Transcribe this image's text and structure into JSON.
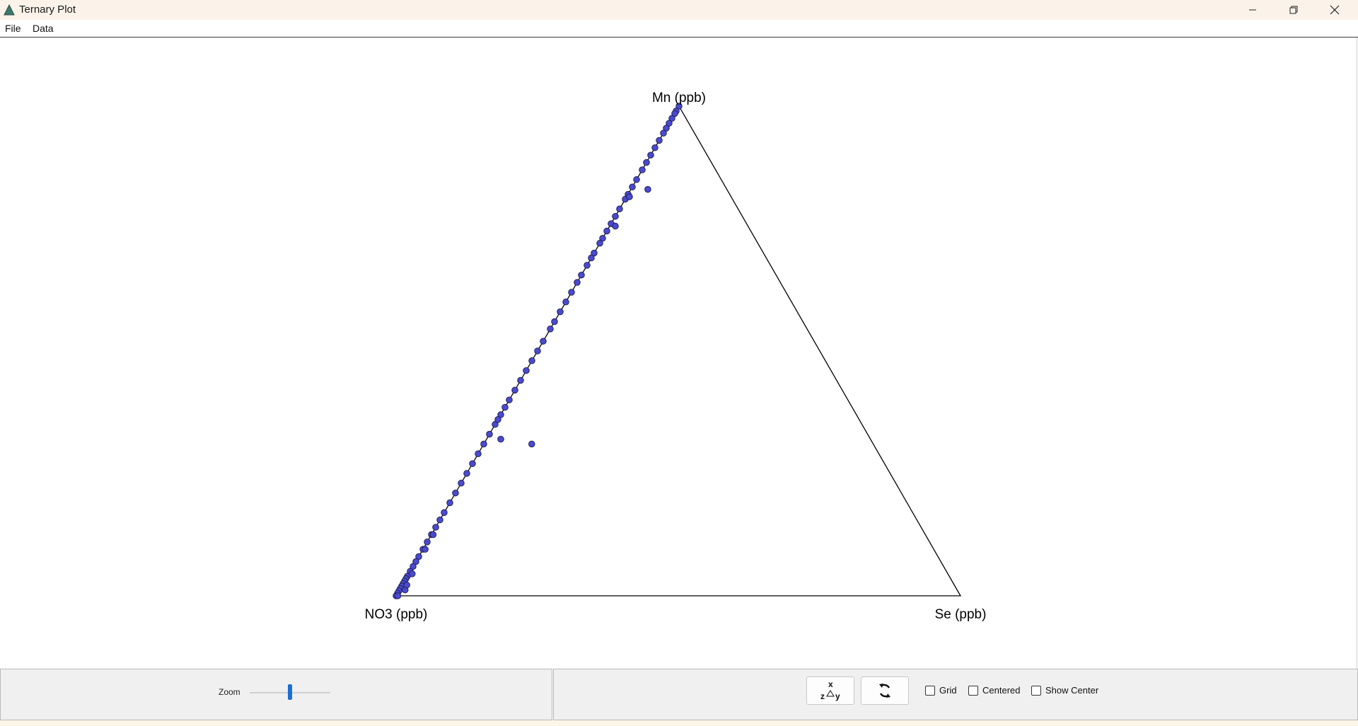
{
  "window": {
    "title": "Ternary Plot"
  },
  "menu": {
    "items": [
      "File",
      "Data"
    ]
  },
  "plot": {
    "top_label": "Mn (ppb)",
    "left_label": "NO3 (ppb)",
    "right_label": "Se (ppb)",
    "point_color": "#4a4ad0",
    "point_stroke": "#1a1a4a"
  },
  "chart_data": {
    "type": "scatter",
    "subtype": "ternary",
    "components": [
      "Mn (ppb)",
      "NO3 (ppb)",
      "Se (ppb)"
    ],
    "grid": false,
    "points": [
      {
        "Mn": 1.0,
        "Se": 0.0
      },
      {
        "Mn": 0.99,
        "Se": 0.0
      },
      {
        "Mn": 0.985,
        "Se": 0.0
      },
      {
        "Mn": 0.975,
        "Se": 0.0
      },
      {
        "Mn": 0.965,
        "Se": 0.0
      },
      {
        "Mn": 0.955,
        "Se": 0.0
      },
      {
        "Mn": 0.945,
        "Se": 0.0
      },
      {
        "Mn": 0.93,
        "Se": 0.0
      },
      {
        "Mn": 0.915,
        "Se": 0.0
      },
      {
        "Mn": 0.9,
        "Se": 0.0
      },
      {
        "Mn": 0.885,
        "Se": 0.0
      },
      {
        "Mn": 0.87,
        "Se": 0.0
      },
      {
        "Mn": 0.85,
        "Se": 0.0
      },
      {
        "Mn": 0.835,
        "Se": 0.0
      },
      {
        "Mn": 0.82,
        "Se": 0.0
      },
      {
        "Mn": 0.81,
        "Se": 0.0
      },
      {
        "Mn": 0.79,
        "Se": 0.0
      },
      {
        "Mn": 0.775,
        "Se": 0.0
      },
      {
        "Mn": 0.76,
        "Se": 0.0
      },
      {
        "Mn": 0.745,
        "Se": 0.0
      },
      {
        "Mn": 0.73,
        "Se": 0.0
      },
      {
        "Mn": 0.72,
        "Se": 0.0
      },
      {
        "Mn": 0.7,
        "Se": 0.0
      },
      {
        "Mn": 0.69,
        "Se": 0.0
      },
      {
        "Mn": 0.675,
        "Se": 0.0
      },
      {
        "Mn": 0.655,
        "Se": 0.0
      },
      {
        "Mn": 0.64,
        "Se": 0.0
      },
      {
        "Mn": 0.62,
        "Se": 0.0
      },
      {
        "Mn": 0.6,
        "Se": 0.0
      },
      {
        "Mn": 0.58,
        "Se": 0.0
      },
      {
        "Mn": 0.56,
        "Se": 0.0
      },
      {
        "Mn": 0.545,
        "Se": 0.0
      },
      {
        "Mn": 0.52,
        "Se": 0.0
      },
      {
        "Mn": 0.5,
        "Se": 0.0
      },
      {
        "Mn": 0.48,
        "Se": 0.0
      },
      {
        "Mn": 0.46,
        "Se": 0.0
      },
      {
        "Mn": 0.44,
        "Se": 0.0
      },
      {
        "Mn": 0.42,
        "Se": 0.0
      },
      {
        "Mn": 0.4,
        "Se": 0.0
      },
      {
        "Mn": 0.385,
        "Se": 0.0
      },
      {
        "Mn": 0.37,
        "Se": 0.0
      },
      {
        "Mn": 0.35,
        "Se": 0.0
      },
      {
        "Mn": 0.33,
        "Se": 0.0
      },
      {
        "Mn": 0.31,
        "Se": 0.0
      },
      {
        "Mn": 0.29,
        "Se": 0.0
      },
      {
        "Mn": 0.27,
        "Se": 0.0
      },
      {
        "Mn": 0.25,
        "Se": 0.0
      },
      {
        "Mn": 0.23,
        "Se": 0.0
      },
      {
        "Mn": 0.21,
        "Se": 0.0
      },
      {
        "Mn": 0.19,
        "Se": 0.0
      },
      {
        "Mn": 0.17,
        "Se": 0.0
      },
      {
        "Mn": 0.155,
        "Se": 0.0
      },
      {
        "Mn": 0.14,
        "Se": 0.0
      },
      {
        "Mn": 0.125,
        "Se": 0.0
      },
      {
        "Mn": 0.11,
        "Se": 0.0
      },
      {
        "Mn": 0.095,
        "Se": 0.0
      },
      {
        "Mn": 0.08,
        "Se": 0.0
      },
      {
        "Mn": 0.07,
        "Se": 0.0
      },
      {
        "Mn": 0.06,
        "Se": 0.0
      },
      {
        "Mn": 0.05,
        "Se": 0.0
      },
      {
        "Mn": 0.04,
        "Se": 0.0
      },
      {
        "Mn": 0.035,
        "Se": 0.0
      },
      {
        "Mn": 0.03,
        "Se": 0.0
      },
      {
        "Mn": 0.025,
        "Se": 0.0
      },
      {
        "Mn": 0.02,
        "Se": 0.0
      },
      {
        "Mn": 0.015,
        "Se": 0.0
      },
      {
        "Mn": 0.01,
        "Se": 0.0
      },
      {
        "Mn": 0.005,
        "Se": 0.0
      },
      {
        "Mn": 0.0,
        "Se": 0.0
      },
      {
        "Mn": 0.0,
        "Se": 0.003
      },
      {
        "Mn": 0.012,
        "Se": 0.01
      },
      {
        "Mn": 0.022,
        "Se": 0.008
      },
      {
        "Mn": 0.045,
        "Se": 0.006
      },
      {
        "Mn": 0.095,
        "Se": 0.004
      },
      {
        "Mn": 0.125,
        "Se": 0.003
      },
      {
        "Mn": 0.31,
        "Se": 0.085
      },
      {
        "Mn": 0.32,
        "Se": 0.025
      },
      {
        "Mn": 0.36,
        "Se": 0.0
      },
      {
        "Mn": 0.83,
        "Se": 0.03
      },
      {
        "Mn": 0.815,
        "Se": 0.005
      },
      {
        "Mn": 0.755,
        "Se": 0.01
      }
    ]
  },
  "controls": {
    "zoom_label": "Zoom",
    "zoom_value": 0.5,
    "grid_label": "Grid",
    "grid_checked": false,
    "centered_label": "Centered",
    "centered_checked": false,
    "show_center_label": "Show Center",
    "show_center_checked": false,
    "swap_axes_icon": "xyz-swap-icon",
    "rotate_icon": "rotate-icon"
  }
}
